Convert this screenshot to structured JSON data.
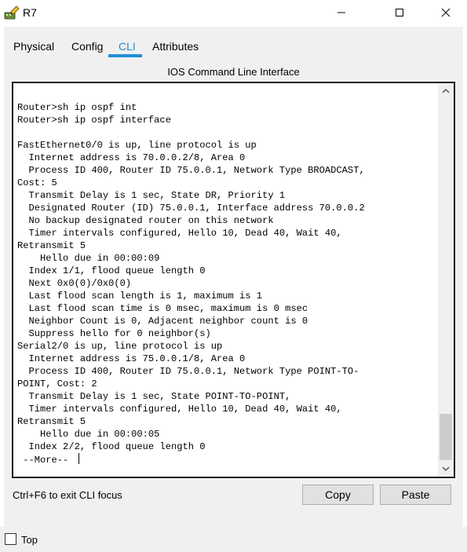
{
  "window": {
    "title": "R7",
    "app_icon": "router-pencil-icon",
    "controls": [
      "minimize-icon",
      "maximize-icon",
      "close-icon"
    ]
  },
  "tabs": [
    {
      "label": "Physical",
      "active": false
    },
    {
      "label": "Config",
      "active": false
    },
    {
      "label": "CLI",
      "active": true
    },
    {
      "label": "Attributes",
      "active": false
    }
  ],
  "panel_title": "IOS Command Line Interface",
  "terminal": {
    "lines": [
      "",
      "Router>sh ip ospf int",
      "Router>sh ip ospf interface",
      "",
      "FastEthernet0/0 is up, line protocol is up",
      "  Internet address is 70.0.0.2/8, Area 0",
      "  Process ID 400, Router ID 75.0.0.1, Network Type BROADCAST,",
      "Cost: 5",
      "  Transmit Delay is 1 sec, State DR, Priority 1",
      "  Designated Router (ID) 75.0.0.1, Interface address 70.0.0.2",
      "  No backup designated router on this network",
      "  Timer intervals configured, Hello 10, Dead 40, Wait 40,",
      "Retransmit 5",
      "    Hello due in 00:00:09",
      "  Index 1/1, flood queue length 0",
      "  Next 0x0(0)/0x0(0)",
      "  Last flood scan length is 1, maximum is 1",
      "  Last flood scan time is 0 msec, maximum is 0 msec",
      "  Neighbor Count is 0, Adjacent neighbor count is 0",
      "  Suppress hello for 0 neighbor(s)",
      "Serial2/0 is up, line protocol is up",
      "  Internet address is 75.0.0.1/8, Area 0",
      "  Process ID 400, Router ID 75.0.0.1, Network Type POINT-TO-",
      "POINT, Cost: 2",
      "  Transmit Delay is 1 sec, State POINT-TO-POINT,",
      "  Timer intervals configured, Hello 10, Dead 40, Wait 40,",
      "Retransmit 5",
      "    Hello due in 00:00:05",
      "  Index 2/2, flood queue length 0"
    ],
    "prompt": " --More-- "
  },
  "footer": {
    "hint": "Ctrl+F6 to exit CLI focus",
    "copy_label": "Copy",
    "paste_label": "Paste"
  },
  "bottom": {
    "top_label": "Top",
    "top_checked": false
  },
  "colors": {
    "accent": "#1e8fd6",
    "panel_bg": "#f0f0f0",
    "button_bg": "#e1e1e1"
  }
}
